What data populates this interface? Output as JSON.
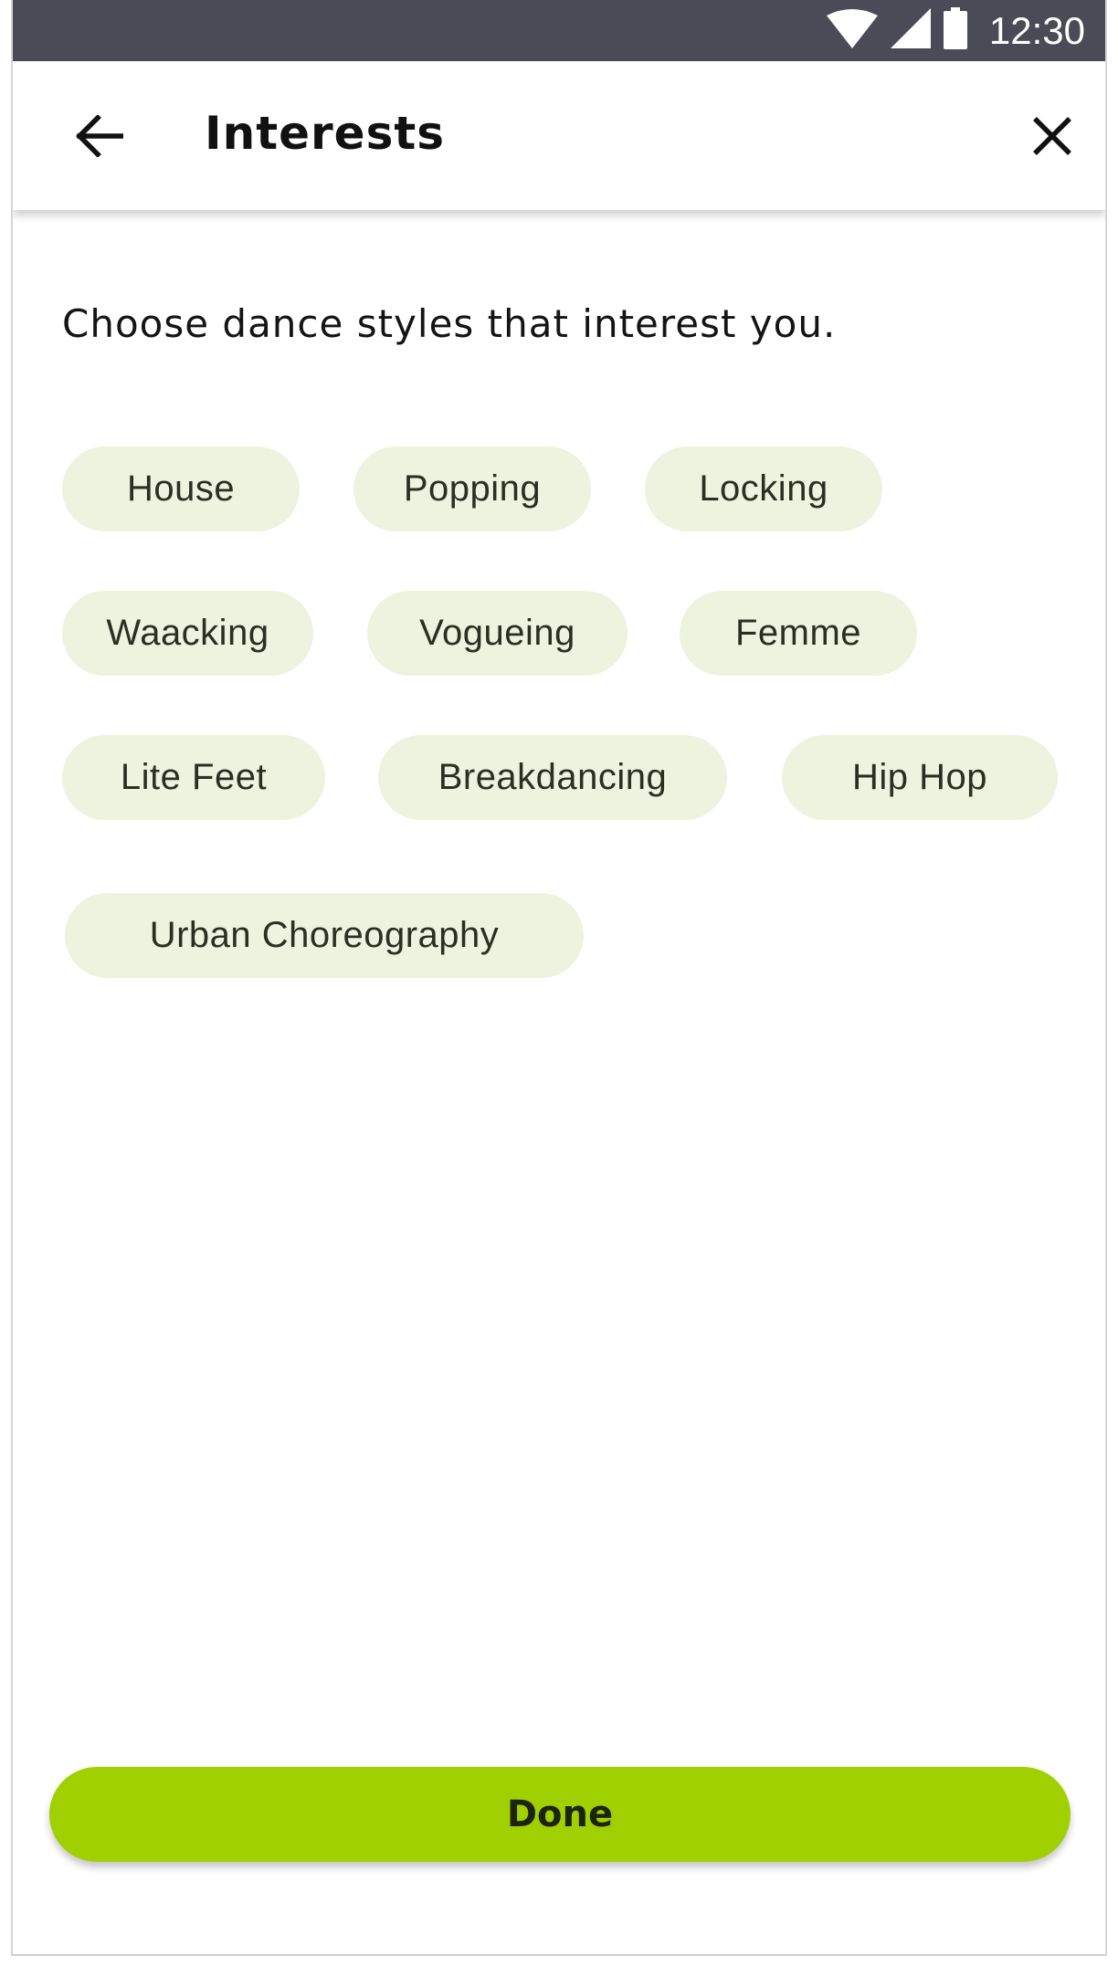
{
  "status_bar": {
    "time": "12:30",
    "icons": [
      "wifi-icon",
      "cellular-signal-icon",
      "battery-icon"
    ]
  },
  "app_bar": {
    "title": "Interests",
    "back_icon": "arrow-left-icon",
    "close_icon": "close-icon"
  },
  "prompt": "Choose dance styles that interest you.",
  "chips": [
    {
      "label": "House"
    },
    {
      "label": "Popping"
    },
    {
      "label": "Locking"
    },
    {
      "label": "Waacking"
    },
    {
      "label": "Vogueing"
    },
    {
      "label": "Femme"
    },
    {
      "label": "Lite Feet"
    },
    {
      "label": "Breakdancing"
    },
    {
      "label": "Hip Hop"
    },
    {
      "label": "Urban Choreography"
    }
  ],
  "done_button": {
    "label": "Done"
  },
  "colors": {
    "status_bar_bg": "#4a4b57",
    "chip_bg": "#eef3df",
    "accent": "#a0d000"
  }
}
